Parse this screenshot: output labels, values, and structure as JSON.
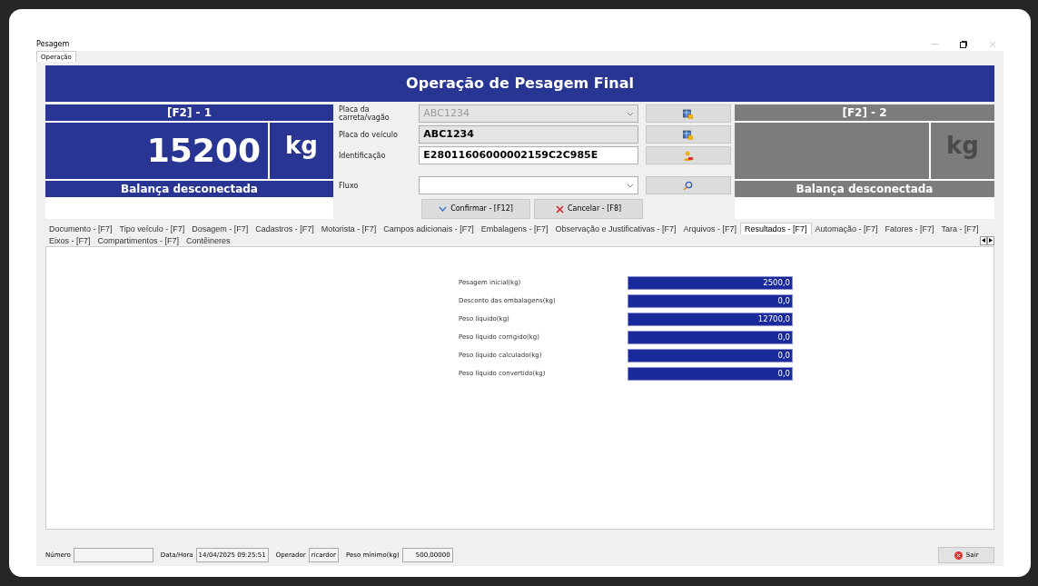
{
  "window": {
    "title": "Pesagem"
  },
  "top_tabs": [
    {
      "label": "Operação",
      "selected": true
    }
  ],
  "header": {
    "title": "Operação de Pesagem Final"
  },
  "scales": [
    {
      "label": "[F2] - 1",
      "value": "15200",
      "unit": "kg",
      "status": "Balança desconectada",
      "selected": true
    },
    {
      "label": "[F2] - 2",
      "unit": "kg",
      "status": "Balança desconectada",
      "selected": false
    }
  ],
  "form": {
    "fields": [
      {
        "label": "Placa da carreta/vagão",
        "value": "ABC1234",
        "kind": "combo",
        "disabled": true,
        "button": {
          "kind": "table"
        }
      },
      {
        "label": "Placa do veículo",
        "value": "ABC1234",
        "kind": "readonly",
        "disabled": false,
        "button": {
          "kind": "table"
        }
      },
      {
        "label": "Identificação",
        "value": "E28011606000002159C2C985E",
        "kind": "text",
        "disabled": false,
        "button": {
          "kind": "user"
        }
      },
      {
        "label": "Fluxo",
        "kind": "combo",
        "disabled": false,
        "button": {
          "kind": "search"
        }
      }
    ],
    "buttons": [
      {
        "label": "Confirmar - [F12]",
        "kind": "confirm"
      },
      {
        "label": "Cancelar - [F8]",
        "kind": "cancel"
      }
    ]
  },
  "sub_tabs": [
    {
      "label": "Documento - [F7]",
      "selected": false
    },
    {
      "label": "Tipo veículo - [F7]",
      "selected": false
    },
    {
      "label": "Dosagem - [F7]",
      "selected": false
    },
    {
      "label": "Cadastros - [F7]",
      "selected": false
    },
    {
      "label": "Motorista - [F7]",
      "selected": false
    },
    {
      "label": "Campos adicionais - [F7]",
      "selected": false
    },
    {
      "label": "Embalagens - [F7]",
      "selected": false
    },
    {
      "label": "Observação e Justificativas - [F7]",
      "selected": false
    },
    {
      "label": "Arquivos - [F7]",
      "selected": false
    },
    {
      "label": "Resultados - [F7]",
      "selected": true
    },
    {
      "label": "Automação - [F7]",
      "selected": false
    },
    {
      "label": "Fatores - [F7]",
      "selected": false
    },
    {
      "label": "Tara - [F7]",
      "selected": false
    },
    {
      "label": "Eixos - [F7]",
      "selected": false
    },
    {
      "label": "Compartimentos - [F7]",
      "selected": false
    },
    {
      "label": "Contêineres",
      "selected": false
    }
  ],
  "results": [
    {
      "label": "Pesagem inicial(kg)",
      "value": "2500,0"
    },
    {
      "label": "Desconto das embalagens(kg)",
      "value": "0,0"
    },
    {
      "label": "Peso líquido(kg)",
      "value": "12700,0"
    },
    {
      "label": "Peso líquido corrigido(kg)",
      "value": "0,0"
    },
    {
      "label": "Peso líquido calculado(kg)",
      "value": "0,0"
    },
    {
      "label": "Peso líquido convertido(kg)",
      "value": "0,0"
    }
  ],
  "status_bar": {
    "fields": [
      {
        "label": "Número"
      },
      {
        "label": "Data/Hora",
        "value": "14/04/2025 09:25:51"
      },
      {
        "label": "Operador",
        "value": "ricardor"
      },
      {
        "label": "Peso mínimo(kg)",
        "value": "500,00000"
      }
    ],
    "exit_button": "Sair"
  }
}
